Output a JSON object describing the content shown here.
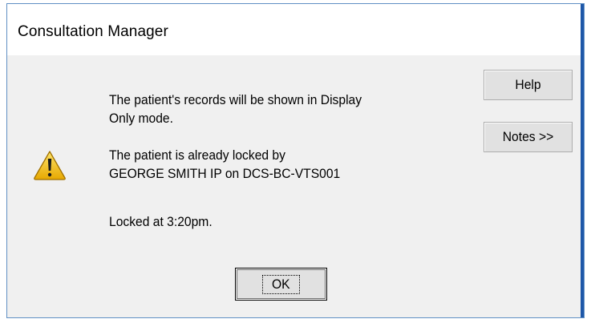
{
  "dialog": {
    "title": "Consultation Manager",
    "icon": "warning-icon",
    "message": {
      "line1": "The patient's records will be shown in Display",
      "line2": "Only mode.",
      "line3": "The patient is already locked by",
      "line4": "GEORGE SMITH IP on DCS-BC-VTS001",
      "line5": "Locked at 3:20pm."
    },
    "buttons": {
      "help": "Help",
      "notes": "Notes >>",
      "ok": "OK"
    }
  },
  "colors": {
    "window_border": "#1e57a8",
    "client_bg": "#f0f0f0",
    "button_face": "#e1e1e1",
    "warning_yellow": "#f5c400"
  }
}
